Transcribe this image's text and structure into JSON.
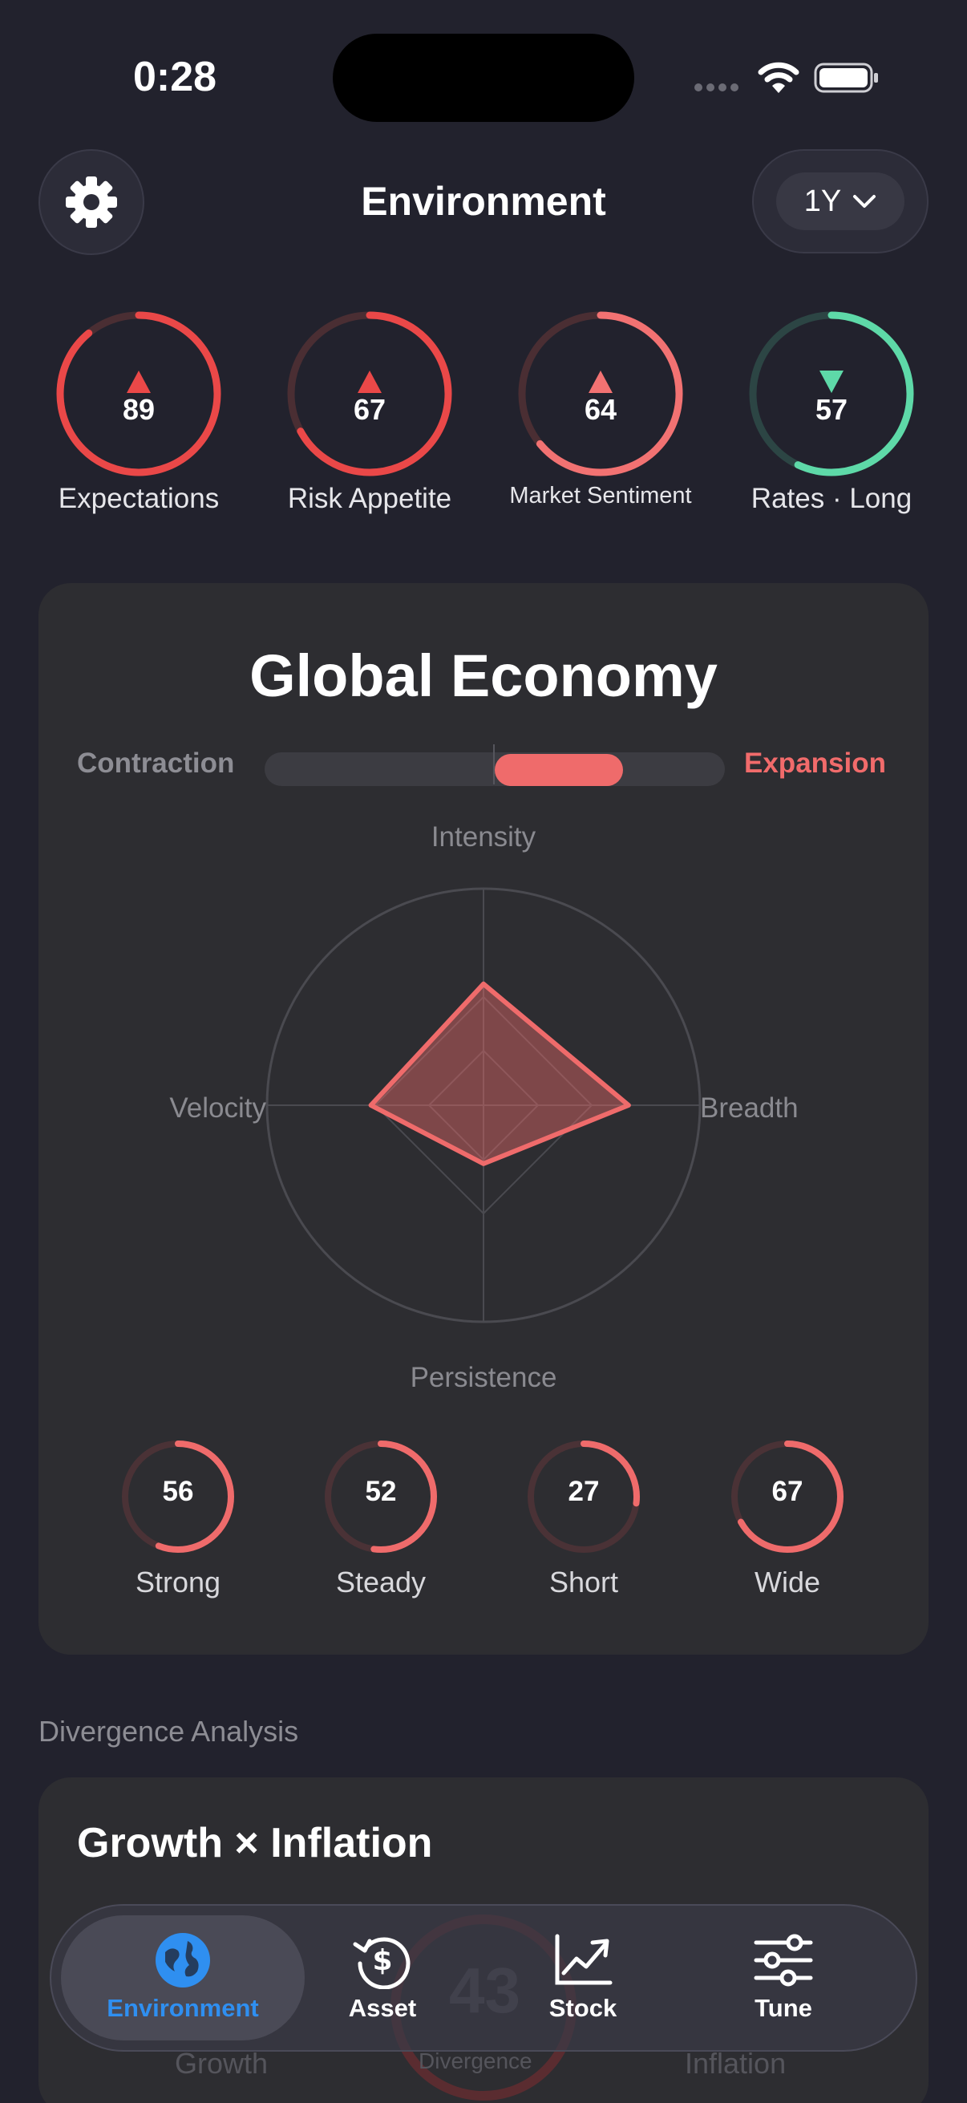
{
  "status": {
    "time": "0:28"
  },
  "header": {
    "title": "Environment",
    "period": "1Y"
  },
  "gauges": [
    {
      "label": "Expectations",
      "value": "89",
      "direction": "up",
      "color": "#ea4848"
    },
    {
      "label": "Risk Appetite",
      "value": "67",
      "direction": "up",
      "color": "#ea4848"
    },
    {
      "label": "Market Sentiment",
      "value": "64",
      "direction": "up",
      "color": "#f27272"
    },
    {
      "label": "Rates · Long",
      "value": "57",
      "direction": "down",
      "color": "#5ed9a8"
    }
  ],
  "global": {
    "title": "Global Economy",
    "left_label": "Contraction",
    "right_label": "Expansion",
    "radar": {
      "axes": [
        "Intensity",
        "Breadth",
        "Persistence",
        "Velocity"
      ],
      "values": [
        0.56,
        0.67,
        0.27,
        0.52
      ]
    },
    "metrics": [
      {
        "value": "56",
        "label": "Strong"
      },
      {
        "value": "52",
        "label": "Steady"
      },
      {
        "value": "27",
        "label": "Short"
      },
      {
        "value": "67",
        "label": "Wide"
      }
    ]
  },
  "divergence": {
    "section_label": "Divergence Analysis",
    "title": "Growth × Inflation",
    "growth_label": "Growth",
    "center_value": "43",
    "center_label": "Divergence",
    "inflation_label": "Inflation"
  },
  "tabs": [
    {
      "label": "Environment",
      "active": true
    },
    {
      "label": "Asset",
      "active": false
    },
    {
      "label": "Stock",
      "active": false
    },
    {
      "label": "Tune",
      "active": false
    }
  ],
  "colors": {
    "accent_red": "#ef6b6b",
    "accent_green": "#5ed9a8",
    "active_tab": "#2f8ff0"
  }
}
